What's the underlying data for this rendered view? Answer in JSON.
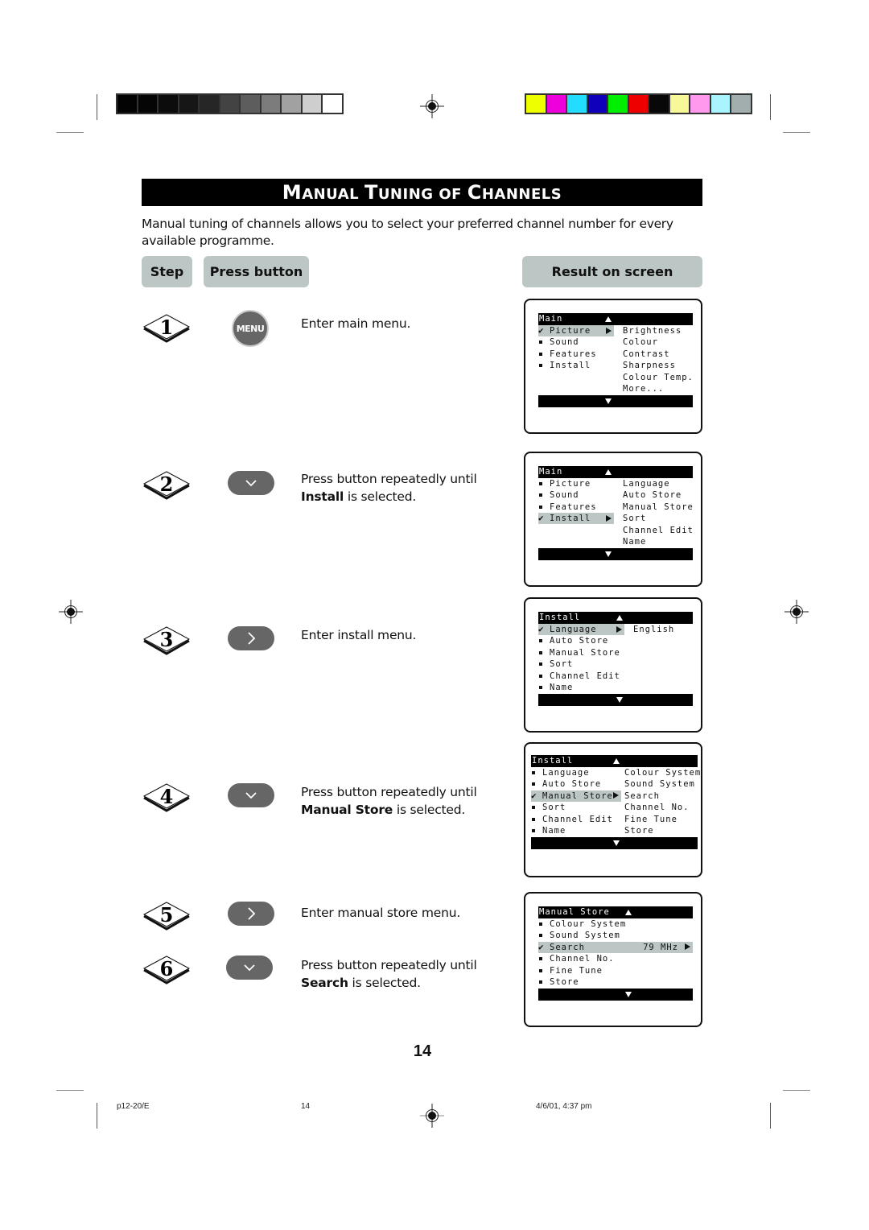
{
  "calibration": {
    "grayscale": [
      "#030303",
      "#050505",
      "#0c0c0c",
      "#161616",
      "#262626",
      "#434343",
      "#5d5d5d",
      "#7c7c7c",
      "#a1a1a1",
      "#cecece",
      "#ffffff"
    ],
    "colors": [
      "#eeff00",
      "#ee00dd",
      "#22ddff",
      "#1100bb",
      "#00ee00",
      "#ee0000",
      "#080808",
      "#f8f898",
      "#ff99ee",
      "#aaf4ff",
      "#a2aeae"
    ]
  },
  "title": {
    "words": [
      {
        "cap": "M",
        "rest": "anual"
      },
      {
        "cap": "T",
        "rest": "uning"
      },
      {
        "cap": "",
        "rest": "of"
      },
      {
        "cap": "C",
        "rest": "hannels"
      }
    ]
  },
  "intro": "Manual tuning of channels allows you to select your preferred channel number for every available programme.",
  "headers": {
    "step": "Step",
    "press_button": "Press button",
    "result": "Result on screen"
  },
  "steps": [
    {
      "number": "1",
      "button": "MENU",
      "button_icon": "menu-button-icon",
      "text_pre": "Enter main menu.",
      "text_bold": "",
      "text_post": ""
    },
    {
      "number": "2",
      "button": "",
      "button_icon": "down-arrow-icon",
      "text_pre": "Press button repeatedly until",
      "text_bold": "Install",
      "text_post": " is selected."
    },
    {
      "number": "3",
      "button": "",
      "button_icon": "right-arrow-icon",
      "text_pre": "Enter install menu.",
      "text_bold": "",
      "text_post": ""
    },
    {
      "number": "4",
      "button": "",
      "button_icon": "down-arrow-icon",
      "text_pre": "Press button repeatedly until",
      "text_bold": "Manual Store",
      "text_post": " is selected."
    },
    {
      "number": "5",
      "button": "",
      "button_icon": "right-arrow-icon",
      "text_pre": "Enter manual store menu.",
      "text_bold": "",
      "text_post": ""
    },
    {
      "number": "6",
      "button": "",
      "button_icon": "down-arrow-icon",
      "text_pre": "Press button repeatedly until",
      "text_bold": "Search",
      "text_post": " is selected."
    }
  ],
  "screens": [
    {
      "title": "Main",
      "items": [
        "Picture",
        "Sound",
        "Features",
        "Install"
      ],
      "selected": 0,
      "submenu": [
        "Brightness",
        "Colour",
        "Contrast",
        "Sharpness",
        "Colour Temp.",
        "More..."
      ]
    },
    {
      "title": "Main",
      "items": [
        "Picture",
        "Sound",
        "Features",
        "Install"
      ],
      "selected": 3,
      "submenu": [
        "Language",
        "Auto Store",
        "Manual Store",
        "Sort",
        "Channel Edit",
        "Name"
      ]
    },
    {
      "title": "Install",
      "items": [
        "Language",
        "Auto Store",
        "Manual Store",
        "Sort",
        "Channel Edit",
        "Name"
      ],
      "selected": 0,
      "submenu": [
        "English"
      ]
    },
    {
      "title": "Install",
      "items": [
        "Language",
        "Auto Store",
        "Manual Store",
        "Sort",
        "Channel Edit",
        "Name"
      ],
      "selected": 2,
      "submenu": [
        "Colour System",
        "Sound System",
        "Search",
        "Channel No.",
        "Fine Tune",
        "Store"
      ]
    },
    {
      "title": "Manual Store",
      "items": [
        "Colour System",
        "Sound System",
        "Search",
        "Channel No.",
        "Fine Tune",
        "Store"
      ],
      "selected": 2,
      "value": "79 MHz"
    }
  ],
  "page_number": "14",
  "footer": {
    "left": "p12-20/E",
    "center": "14",
    "right": "4/6/01, 4:37 pm"
  }
}
